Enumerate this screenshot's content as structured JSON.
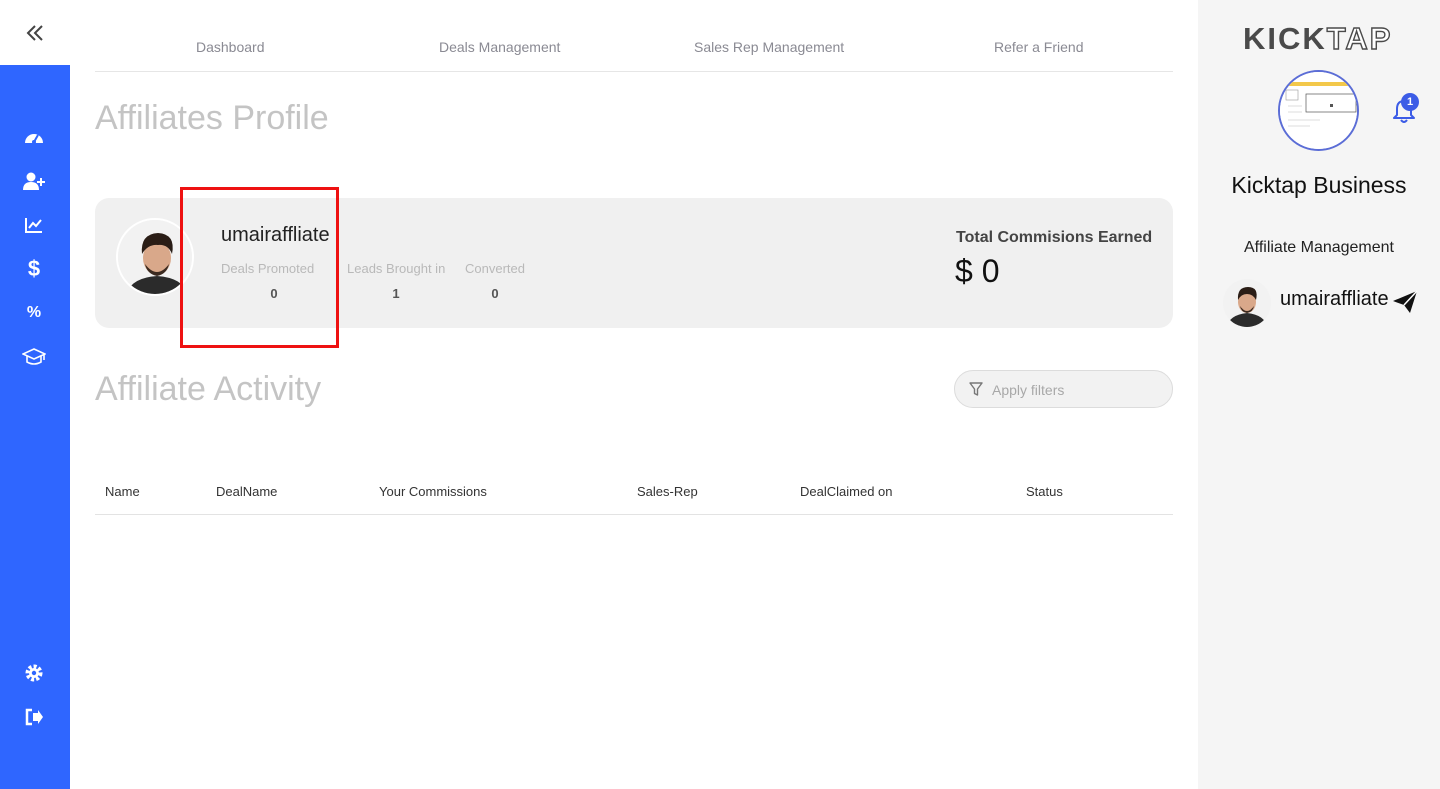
{
  "nav": {
    "items": [
      {
        "label": "Dashboard"
      },
      {
        "label": "Deals Management"
      },
      {
        "label": "Sales Rep Management"
      },
      {
        "label": "Refer a Friend"
      }
    ]
  },
  "sidebar": {
    "icons": [
      "dashboard-icon",
      "add-user-icon",
      "chart-icon",
      "dollar-icon",
      "percent-icon",
      "graduation-cap-icon"
    ],
    "bottom_icons": [
      "settings-icon",
      "logout-icon"
    ],
    "accent": "#2f66ff"
  },
  "profile": {
    "title": "Affiliates Profile",
    "name": "umairaffliate",
    "stats": [
      {
        "label": "Deals Promoted",
        "value": "0"
      },
      {
        "label": "Leads Brought in",
        "value": "1"
      },
      {
        "label": "Converted",
        "value": "0"
      }
    ],
    "commission_label": "Total Commisions Earned",
    "commission_value": "$ 0"
  },
  "activity": {
    "title": "Affiliate Activity",
    "filter_placeholder": "Apply filters",
    "columns": [
      "Name",
      "DealName",
      "Your Commissions",
      "Sales-Rep",
      "DealClaimed on",
      "Status"
    ],
    "rows": []
  },
  "right_panel": {
    "brand_kick": "KICK",
    "brand_tap": "TAP",
    "notification_count": "1",
    "business_name": "Kicktap Business",
    "role": "Affiliate Management",
    "user_name": "umairaffliate"
  }
}
